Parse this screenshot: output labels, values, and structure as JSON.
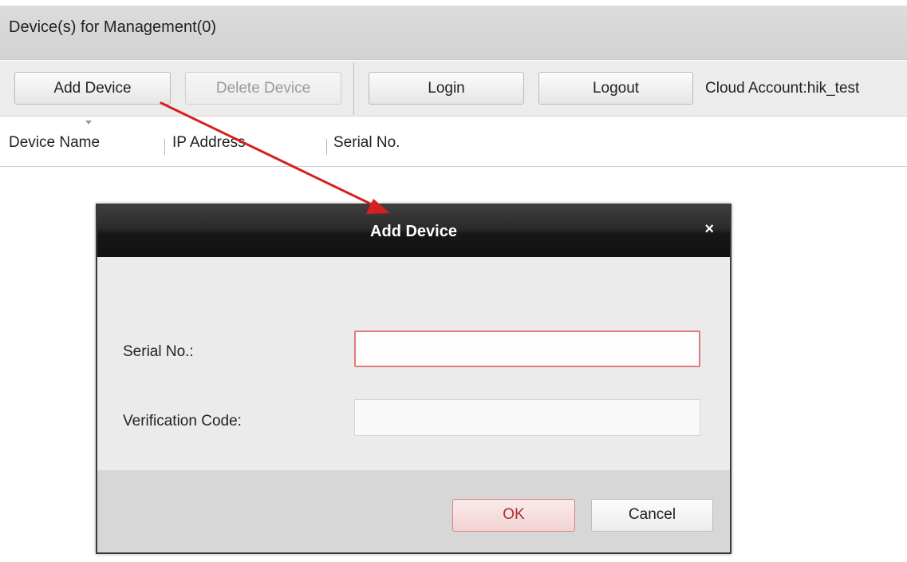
{
  "panel": {
    "title": "Device(s) for Management(0)"
  },
  "toolbar": {
    "add_device_label": "Add Device",
    "delete_device_label": "Delete Device",
    "login_label": "Login",
    "logout_label": "Logout",
    "cloud_account_text": "Cloud Account:hik_test"
  },
  "table": {
    "columns": [
      "Device Name",
      "IP Address",
      "Serial No."
    ]
  },
  "dialog": {
    "title": "Add Device",
    "close_glyph": "×",
    "fields": {
      "serial_label": "Serial No.:",
      "serial_value": "",
      "verification_label": "Verification Code:",
      "verification_value": ""
    },
    "ok_label": "OK",
    "cancel_label": "Cancel"
  },
  "colors": {
    "annotation_arrow": "#d42020",
    "dialog_titlebar": "#1a1a1a",
    "ok_button_text": "#a83232",
    "error_border": "#e07b7b"
  }
}
